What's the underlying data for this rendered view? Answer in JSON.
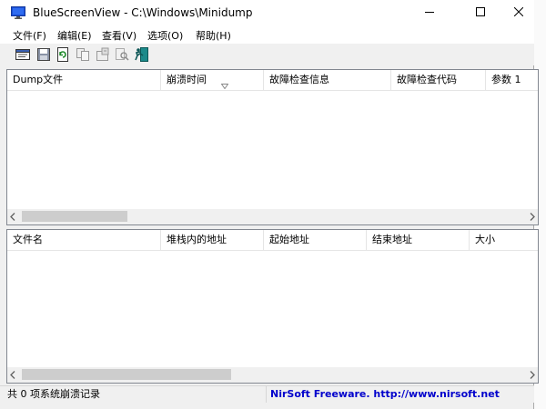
{
  "window": {
    "title": "BlueScreenView  -  C:\\Windows\\Minidump"
  },
  "menu": [
    {
      "label": "文件(F)"
    },
    {
      "label": "编辑(E)"
    },
    {
      "label": "查看(V)"
    },
    {
      "label": "选项(O)"
    },
    {
      "label": "帮助(H)"
    }
  ],
  "toolbar": {
    "icons": [
      "report-icon",
      "save-icon",
      "refresh-icon",
      "copy-icon",
      "properties-icon",
      "find-icon",
      "exit-icon"
    ]
  },
  "crash_list": {
    "columns": [
      "Dump文件",
      "崩溃时间",
      "故障检查信息",
      "故障检查代码",
      "参数 1"
    ],
    "sorted_column": "崩溃时间",
    "rows": []
  },
  "driver_list": {
    "columns": [
      "文件名",
      "堆栈内的地址",
      "起始地址",
      "结束地址",
      "大小"
    ],
    "rows": []
  },
  "status": {
    "count_text": "共 0 项系统崩溃记录",
    "link_text": "NirSoft Freeware.  http://www.nirsoft.net"
  },
  "colors": {
    "link": "#0000cc",
    "app_icon_blue": "#1a4fd6"
  }
}
